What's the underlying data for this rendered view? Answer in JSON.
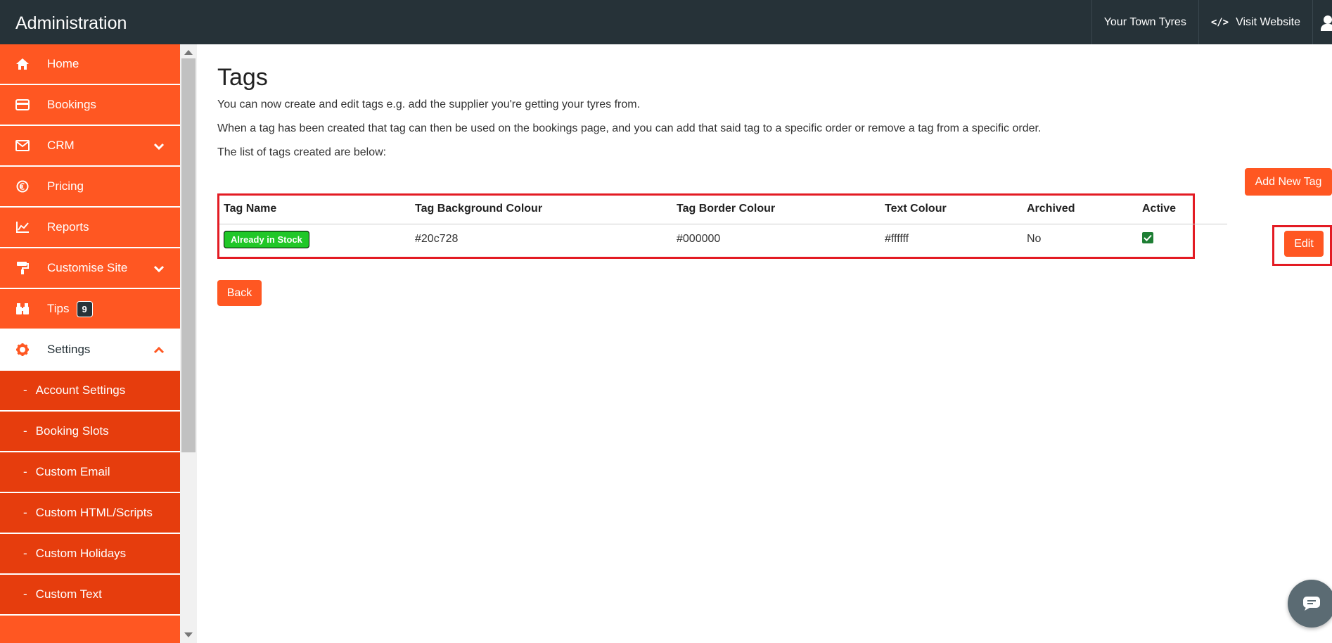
{
  "header": {
    "brand": "Administration",
    "site_name": "Your Town Tyres",
    "visit_website": "Visit Website"
  },
  "sidebar": {
    "items": [
      {
        "label": "Home",
        "icon": "home-icon"
      },
      {
        "label": "Bookings",
        "icon": "credit-card-icon"
      },
      {
        "label": "CRM",
        "icon": "envelope-icon"
      },
      {
        "label": "Pricing",
        "icon": "euro-icon"
      },
      {
        "label": "Reports",
        "icon": "line-chart-icon"
      },
      {
        "label": "Customise Site",
        "icon": "paint-roller-icon"
      },
      {
        "label": "Tips",
        "icon": "binoculars-icon",
        "badge": "9"
      },
      {
        "label": "Settings",
        "icon": "gear-icon"
      }
    ],
    "sub_items": [
      {
        "label": "Account Settings"
      },
      {
        "label": "Booking Slots"
      },
      {
        "label": "Custom Email"
      },
      {
        "label": "Custom HTML/Scripts"
      },
      {
        "label": "Custom Holidays"
      },
      {
        "label": "Custom Text"
      }
    ],
    "sub_dash": "-"
  },
  "main": {
    "title": "Tags",
    "description": [
      "You can now create and edit tags e.g. add the supplier you're getting your tyres from.",
      "When a tag has been created that tag can then be used on the bookings page, and you can add that said tag to a specific order or remove a tag from a specific order.",
      "The list of tags created are below:"
    ],
    "add_button": "Add New Tag",
    "back_button": "Back",
    "table": {
      "headers": [
        "Tag Name",
        "Tag Background Colour",
        "Tag Border Colour",
        "Text Colour",
        "Archived",
        "Active"
      ],
      "rows": [
        {
          "tag_name": "Already in Stock",
          "background": "#20c728",
          "border": "#000000",
          "text": "#ffffff",
          "archived": "No",
          "active": true,
          "edit_label": "Edit"
        }
      ]
    }
  },
  "colors": {
    "accent": "#ff5722",
    "topbar": "#263238",
    "highlight": "#e31b23"
  }
}
